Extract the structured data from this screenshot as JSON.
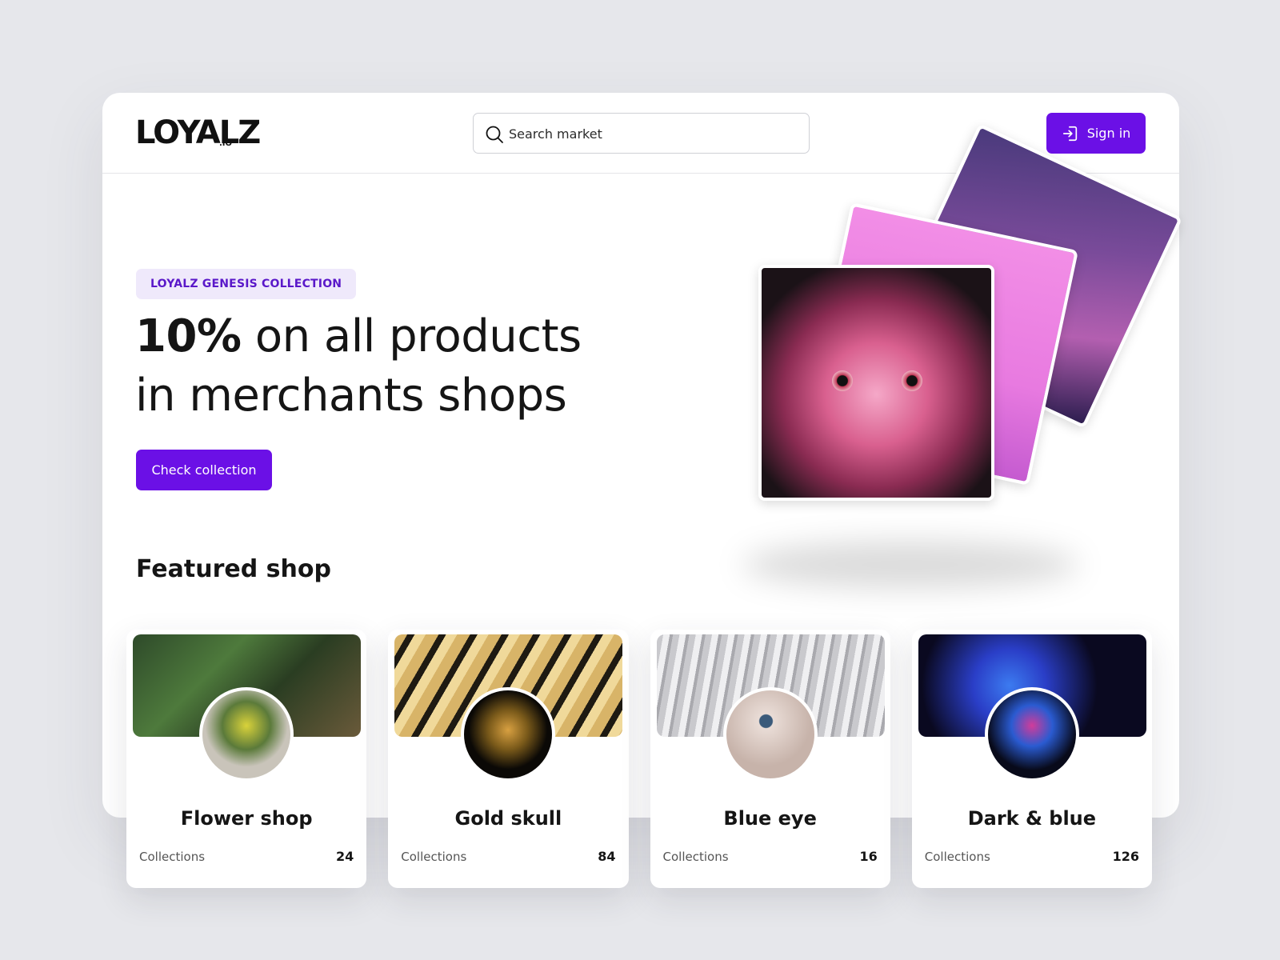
{
  "header": {
    "logo": "LOYALZ",
    "logo_sub": ".IO",
    "search_placeholder": "Search market",
    "signin_label": "Sign in"
  },
  "hero": {
    "badge": "LOYALZ GENESIS COLLECTION",
    "headline_bold": "10%",
    "headline_rest": " on all products",
    "headline_line2": "in merchants shops",
    "cta_label": "Check collection"
  },
  "featured": {
    "title": "Featured shop",
    "shops": [
      {
        "name": "Flower shop",
        "label": "Collections",
        "count": "24"
      },
      {
        "name": "Gold skull",
        "label": "Collections",
        "count": "84"
      },
      {
        "name": "Blue eye",
        "label": "Collections",
        "count": "16"
      },
      {
        "name": "Dark & blue",
        "label": "Collections",
        "count": "126"
      }
    ]
  },
  "colors": {
    "accent": "#6b10e6",
    "badge_bg": "#efe9fb",
    "badge_text": "#5a18c9",
    "page_bg": "#e6e7eb"
  },
  "icons": {
    "search": "search-icon",
    "signin": "sign-in-icon"
  }
}
